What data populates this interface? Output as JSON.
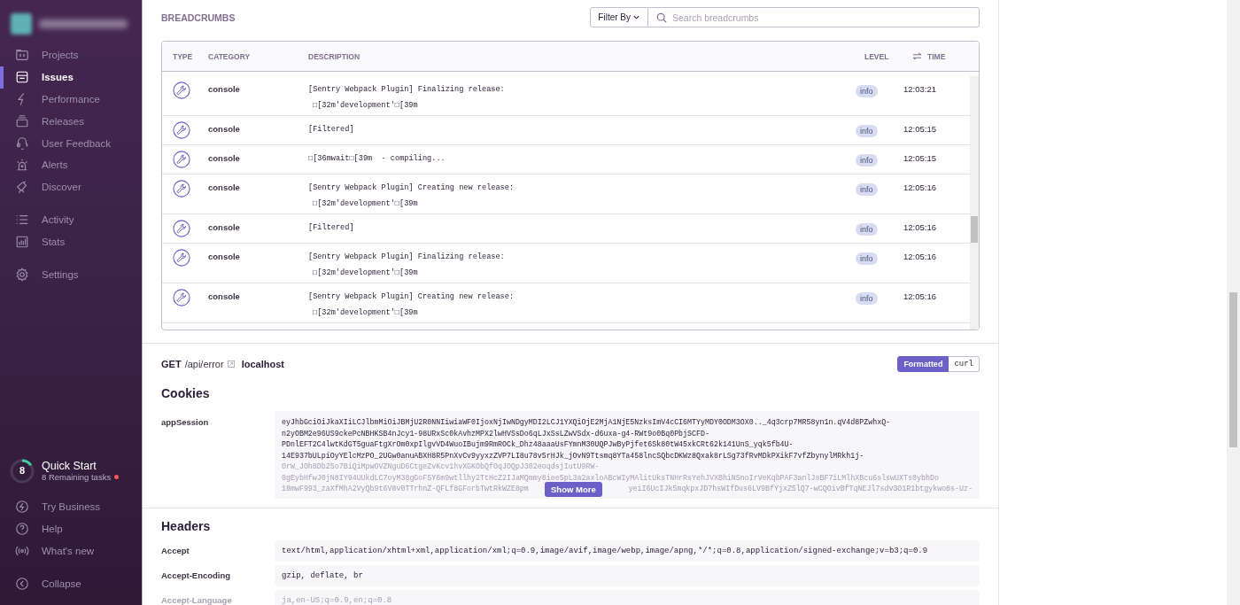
{
  "sidebar": {
    "nav_groups": [
      [
        {
          "label": "Projects",
          "kind": "projects",
          "selected": false
        },
        {
          "label": "Issues",
          "kind": "issues",
          "selected": true
        },
        {
          "label": "Performance",
          "kind": "performance",
          "selected": false
        },
        {
          "label": "Releases",
          "kind": "releases",
          "selected": false
        },
        {
          "label": "User Feedback",
          "kind": "feedback",
          "selected": false
        },
        {
          "label": "Alerts",
          "kind": "alerts",
          "selected": false
        },
        {
          "label": "Discover",
          "kind": "discover",
          "selected": false
        }
      ],
      [
        {
          "label": "Activity",
          "kind": "activity",
          "selected": false
        },
        {
          "label": "Stats",
          "kind": "stats",
          "selected": false
        }
      ],
      [
        {
          "label": "Settings",
          "kind": "settings",
          "selected": false
        }
      ]
    ],
    "quick_start": {
      "count": "8",
      "title": "Quick Start",
      "subtitle": "8 Remaining tasks",
      "level": 0.15
    },
    "footer_items": [
      {
        "label": "Try Business",
        "kind": "business"
      },
      {
        "label": "Help",
        "kind": "help"
      },
      {
        "label": "What's new",
        "kind": "broadcast"
      }
    ],
    "collapse": "Collapse"
  },
  "breadcrumbs": {
    "title": "BREADCRUMBS",
    "filter_label": "Filter By",
    "search_placeholder": "Search breadcrumbs",
    "columns": [
      "TYPE",
      "CATEGORY",
      "DESCRIPTION",
      "LEVEL",
      "TIME"
    ],
    "rows": [
      {
        "category": "console",
        "description": [
          "[Sentry Webpack Plugin] Finalizing release:",
          "□[32m'development'□[39m"
        ],
        "severity": "info",
        "time": "12:03:21"
      },
      {
        "category": "console",
        "description": [
          "[Filtered]"
        ],
        "severity": "info",
        "time": "12:05:15"
      },
      {
        "category": "console",
        "description": [
          "□[36mwait□[39m  - compiling..."
        ],
        "severity": "info",
        "time": "12:05:15"
      },
      {
        "category": "console",
        "description": [
          "[Sentry Webpack Plugin] Creating new release:",
          "□[32m'development'□[39m"
        ],
        "severity": "info",
        "time": "12:05:16"
      },
      {
        "category": "console",
        "description": [
          "[Filtered]"
        ],
        "severity": "info",
        "time": "12:05:16"
      },
      {
        "category": "console",
        "description": [
          "[Sentry Webpack Plugin] Finalizing release:",
          "□[32m'development'□[39m"
        ],
        "severity": "info",
        "time": "12:05:16"
      },
      {
        "category": "console",
        "description": [
          "[Sentry Webpack Plugin] Creating new release:",
          "□[32m'development'□[39m"
        ],
        "severity": "info",
        "time": "12:05:16"
      }
    ]
  },
  "request": {
    "method": "GET",
    "path": "/api/error",
    "host": "localhost",
    "view_tabs": [
      {
        "label": "Formatted",
        "selected": true
      },
      {
        "label": "curl",
        "selected": false
      }
    ]
  },
  "cookies": {
    "title": "Cookies",
    "rows": [
      {
        "name": "appSession",
        "lines": [
          "eyJhbGciOiJkaXIiLCJlbmMiOiJBMjU2R0NNIiwiaWF0IjoxNjIwNDgyMDI2LCJ1YXQiOjE2MjA1NjE5NzksImV4cCI6MTYyMDY0ODM3OX0.._4q3crp7MR58yn1n.qV4d8PZwhxQ-",
          "n2yOBM2e96US9ckePcNBHKSB4nJcy1-98URxSc0kAvhzMPX2lwHVSsDo6qLJxSsLZwVSdx-d6uxa-g4-RWt9o0Bq0PbjSCFD-",
          "PDnlEFT2C4lwtKdGT5guaFtgXrOm0xpIlgvVD4WuoIBujm9RmROCk_Dhz48aaaUsFYmnM30UQPJwByPjfet6Sk80tW45xkCRt62k141UnS_yqk5fb4U-",
          "14E937bULpiOyYElcMzPO_2UGw0anuABXH8R5PnXvCv9yyxzZVP7LI8u78v5rHJk_jOvN9Ttsmq8YTa458lncSQbcDKWz8Qxak8rLSg73fRvMDkPXikF7vfZbynylMRkh1j-"
        ],
        "faded_lines": [
          "OrW_JOh8Db25o7BiQiMpwOVZNguD6CtgeZvKcv1hvXGKObQfOqJOQpJ302eoqdsjIutU9RW-",
          "0gEybHfwJ0jN8IY94UUkdLC7oyM38gGoF5Y6m9wtllhy2TtHcZ2IJaMQmmy8iee5pL3a2axloABcWIyMAlitUksTNHrRsYehJVXBhiNSnoIrVeKqbPAF3anlJsBF7iLMlhXBcu6slswUXTs0ybhDo"
        ],
        "cut_line": [
          "18mwF993_zaXfMhA2VyQb9t6V8v0TTrhnZ-QFLf8GForbTwtRkWZE8pm",
          "yeiI6UcIJk5mqkpxJD7hsWIfDus6LV9BfYjxZ5lQ7-wCQOivBfTqNEJl7sdv3O1R1btgykwo8s-Uz-"
        ],
        "button": "Show More"
      }
    ]
  },
  "headers": {
    "title": "Headers",
    "rows": [
      {
        "name": "Accept",
        "value": "text/html,application/xhtml+xml,application/xml;q=0.9,image/avif,image/webp,image/apng,*/*;q=0.8,application/signed-exchange;v=b3;q=0.9"
      },
      {
        "name": "Accept-Encoding",
        "value": "gzip, deflate, br"
      },
      {
        "name": "Accept-Language",
        "value": "ja,en-US;q=0.9,en;q=0.8"
      }
    ]
  }
}
